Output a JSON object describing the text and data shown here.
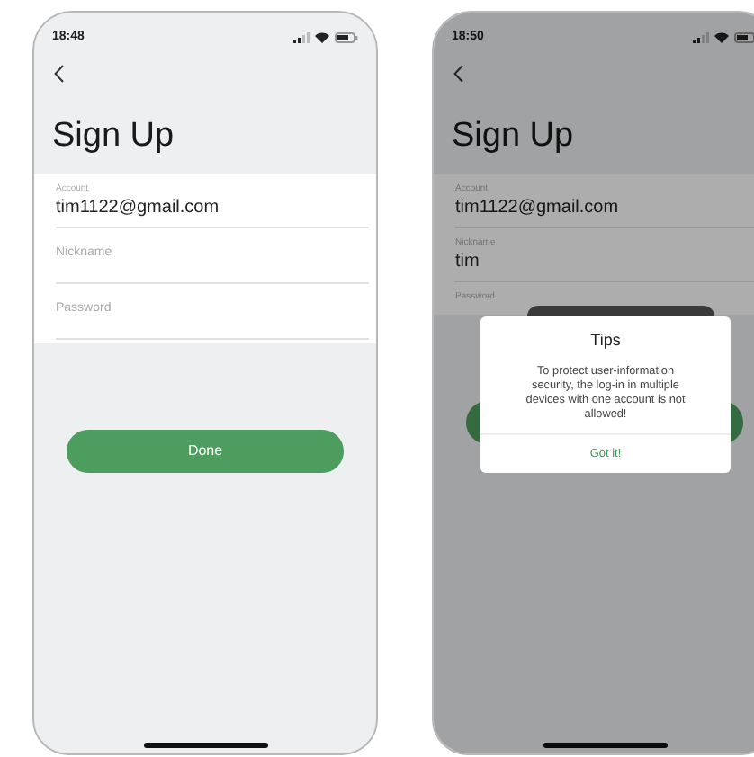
{
  "phones": [
    {
      "time": "18:48",
      "title": "Sign Up",
      "fields": [
        {
          "kind": "filled",
          "label": "Account",
          "value": "tim1122@gmail.com"
        },
        {
          "kind": "empty",
          "placeholder": "Nickname"
        },
        {
          "kind": "empty",
          "placeholder": "Password"
        }
      ],
      "button": "Done"
    },
    {
      "time": "18:50",
      "title": "Sign Up",
      "fields": [
        {
          "kind": "filled",
          "label": "Account",
          "value": "tim1122@gmail.com"
        },
        {
          "kind": "filled",
          "label": "Nickname",
          "value": "tim"
        },
        {
          "kind": "focused",
          "label": "Password"
        }
      ],
      "dialog": {
        "title": "Tips",
        "message": "To protect user-information security, the log-in in multiple devices with one account is not allowed!",
        "action": "Got it!"
      }
    }
  ]
}
